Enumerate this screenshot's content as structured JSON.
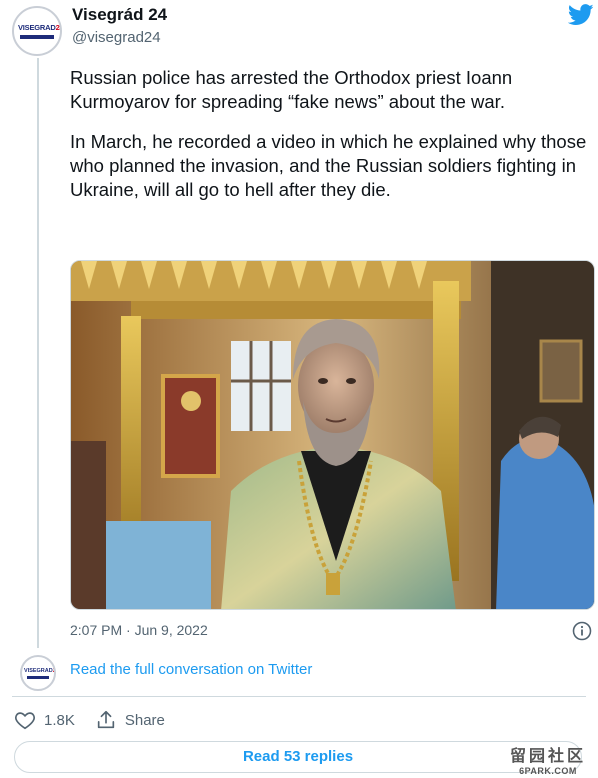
{
  "tweet": {
    "author_name": "Visegrád 24",
    "author_handle": "@visegrad24",
    "avatar_logo": [
      "VISEGRAD",
      "24"
    ],
    "paragraphs": [
      "Russian police has arrested the Orthodox priest Ioann Kurmoyarov for spreading “fake news” about the war.",
      "In March, he recorded a video in which he explained why those who planned the invasion, and the Russian soldiers fighting in Ukraine,  will all go to hell after they die."
    ],
    "timestamp": "2:07 PM · Jun 9, 2022",
    "read_conversation": "Read the full conversation on Twitter",
    "likes": "1.8K",
    "share_label": "Share",
    "read_replies": "Read 53 replies"
  },
  "watermark": {
    "chinese": "留园社区",
    "site": "6PARK.COM"
  },
  "colors": {
    "accent": "#1d9bf0",
    "text": "#0f1419",
    "muted": "#536471",
    "border": "#cfd9de"
  }
}
